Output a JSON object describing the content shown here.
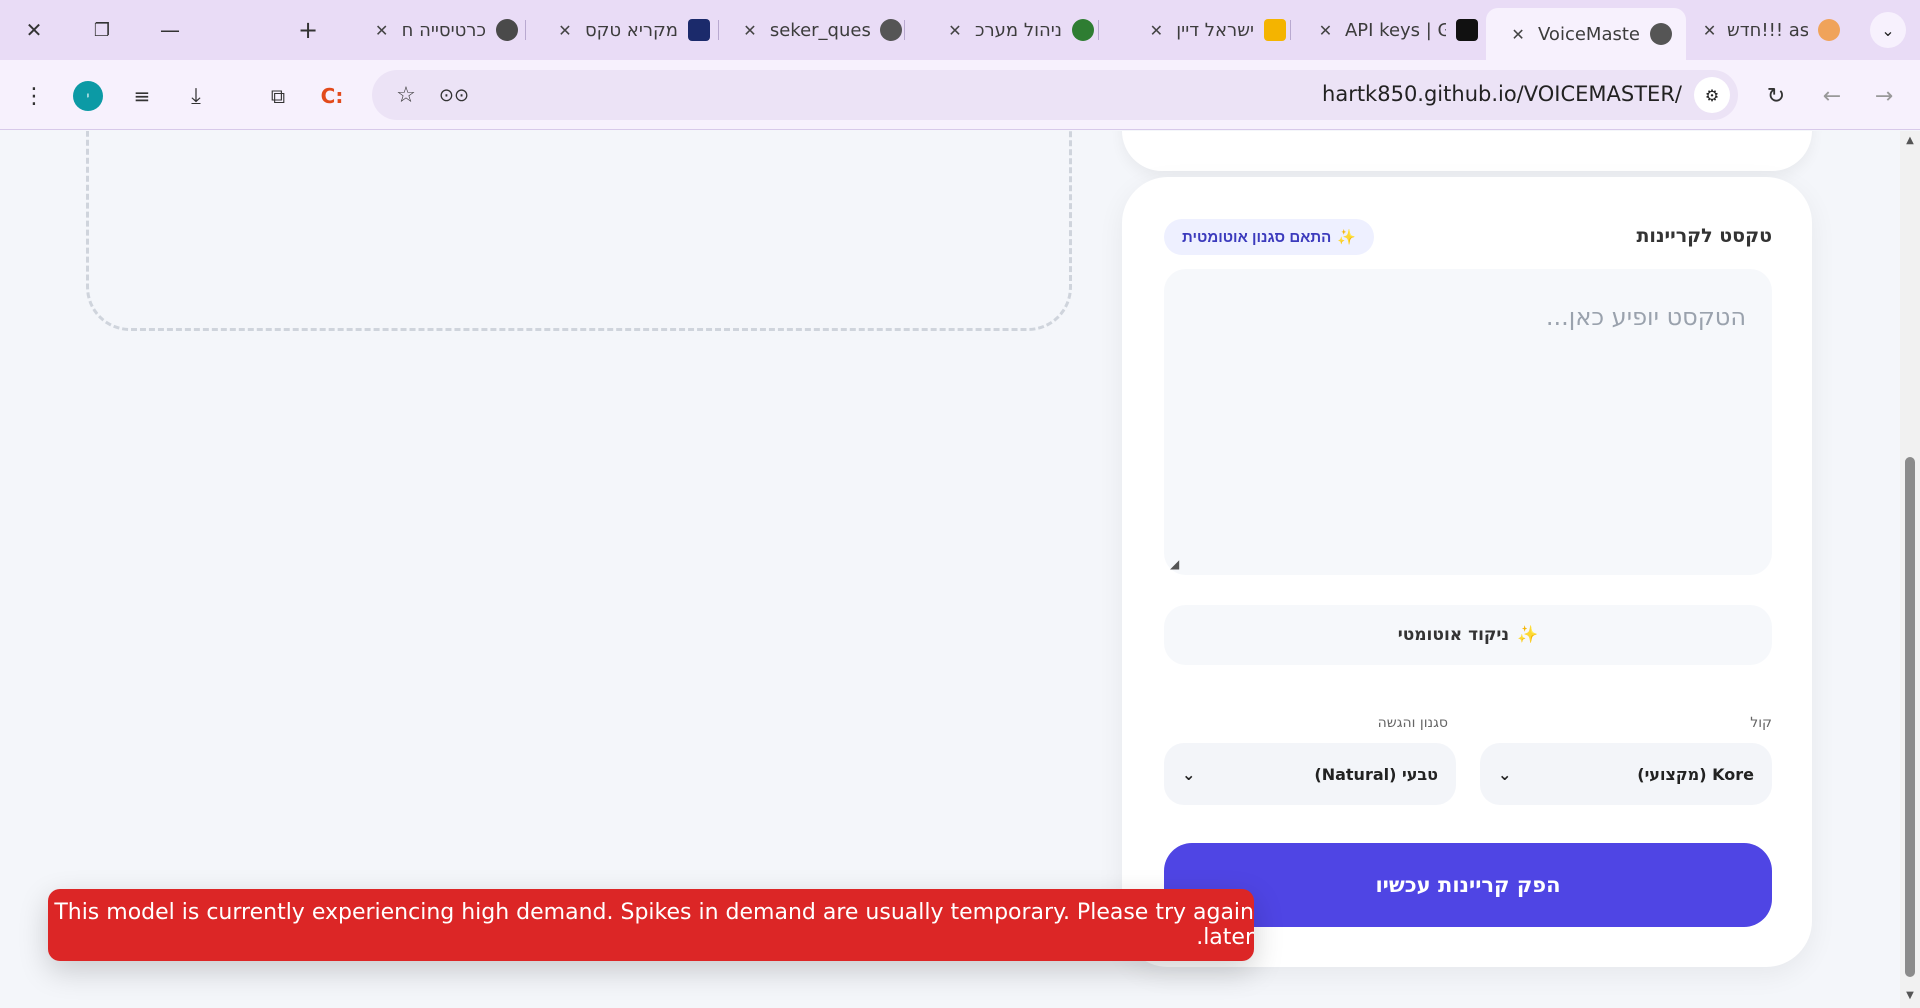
{
  "browser": {
    "tabs": [
      {
        "title": "כרטיסייה ח",
        "icon_color": "#4a4a4a",
        "icon": "chrome-icon"
      },
      {
        "title": "מקריא טקס",
        "icon_color": "#1b2a6b",
        "icon": "portrait-icon"
      },
      {
        "title": "seker_ques",
        "icon_color": "#555555",
        "icon": "globe-icon"
      },
      {
        "title": "ניהול מערכ",
        "icon_color": "#2e7d32",
        "icon": "badge-icon"
      },
      {
        "title": "ישראל דיין",
        "icon_color": "#f4b400",
        "icon": "slides-icon"
      },
      {
        "title": "API keys | G",
        "icon_color": "#111111",
        "icon": "openai-icon"
      },
      {
        "title": "VoiceMaste",
        "icon_color": "#555555",
        "icon": "globe-icon",
        "active": true
      },
      {
        "title": "חדש!!! aster",
        "icon_color": "#f0a35a",
        "icon": "star-icon"
      }
    ],
    "url": "hartk850.github.io/VOICEMASTER/",
    "profile_initial": "י",
    "accent": "#e9dcf6"
  },
  "card": {
    "title": "טקסט לקריינות",
    "auto_style_label": "התאם סגנון אוטומטית",
    "text_placeholder": "הטקסט יופיע כאן...",
    "niqud_label": "ניקוד אוטומטי",
    "voice_label": "קול",
    "voice_value": "Kore (מקצועי)",
    "style_label": "סגנון והגשה",
    "style_value": "טבעי (Natural)",
    "generate_label": "הפק קריינות עכשיו",
    "sparkle": "✨"
  },
  "toast": {
    "message": "This model is currently experiencing high demand. Spikes in demand are usually temporary. Please try again later.",
    "color": "#dc2626"
  },
  "colors": {
    "primary": "#4f45e4",
    "error": "#dc2626"
  }
}
